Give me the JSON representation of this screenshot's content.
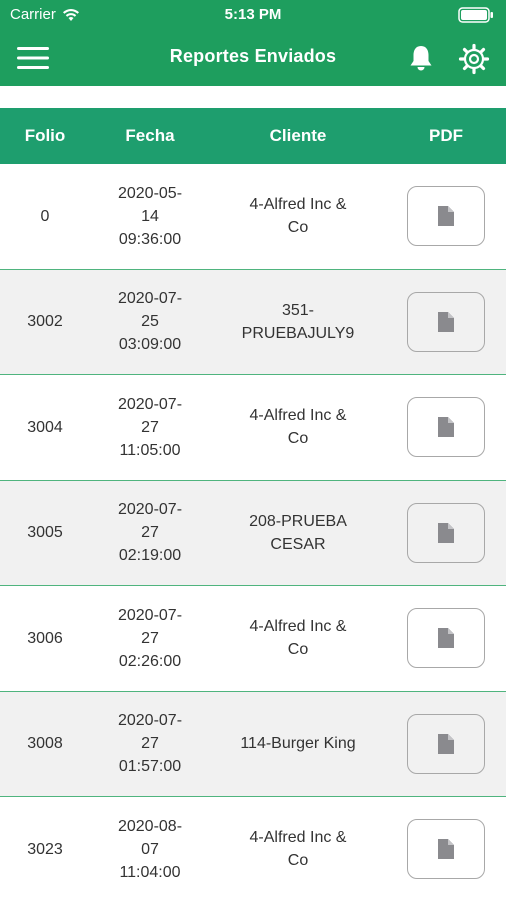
{
  "statusbar": {
    "carrier": "Carrier",
    "time": "5:13 PM"
  },
  "navbar": {
    "title": "Reportes Enviados",
    "menu_icon": "hamburger-icon",
    "bell_icon": "bell-icon",
    "settings_icon": "gear-icon"
  },
  "table": {
    "headers": {
      "folio": "Folio",
      "fecha": "Fecha",
      "cliente": "Cliente",
      "pdf": "PDF"
    },
    "rows": [
      {
        "folio": "0",
        "fecha": "2020-05-\n14\n09:36:00",
        "cliente": "4-Alfred Inc &\nCo"
      },
      {
        "folio": "3002",
        "fecha": "2020-07-\n25\n03:09:00",
        "cliente": "351-\nPRUEBAJULY9"
      },
      {
        "folio": "3004",
        "fecha": "2020-07-\n27\n11:05:00",
        "cliente": "4-Alfred Inc &\nCo"
      },
      {
        "folio": "3005",
        "fecha": "2020-07-\n27\n02:19:00",
        "cliente": "208-PRUEBA\nCESAR"
      },
      {
        "folio": "3006",
        "fecha": "2020-07-\n27\n02:26:00",
        "cliente": "4-Alfred Inc &\nCo"
      },
      {
        "folio": "3008",
        "fecha": "2020-07-\n27\n01:57:00",
        "cliente": "114-Burger King"
      },
      {
        "folio": "3023",
        "fecha": "2020-08-\n07\n11:04:00",
        "cliente": "4-Alfred Inc &\nCo"
      }
    ]
  },
  "colors": {
    "brand_green": "#1e9e5e",
    "header_green": "#1e9e6e",
    "row_alt": "#f1f1f1",
    "divider": "#4fb47e"
  }
}
